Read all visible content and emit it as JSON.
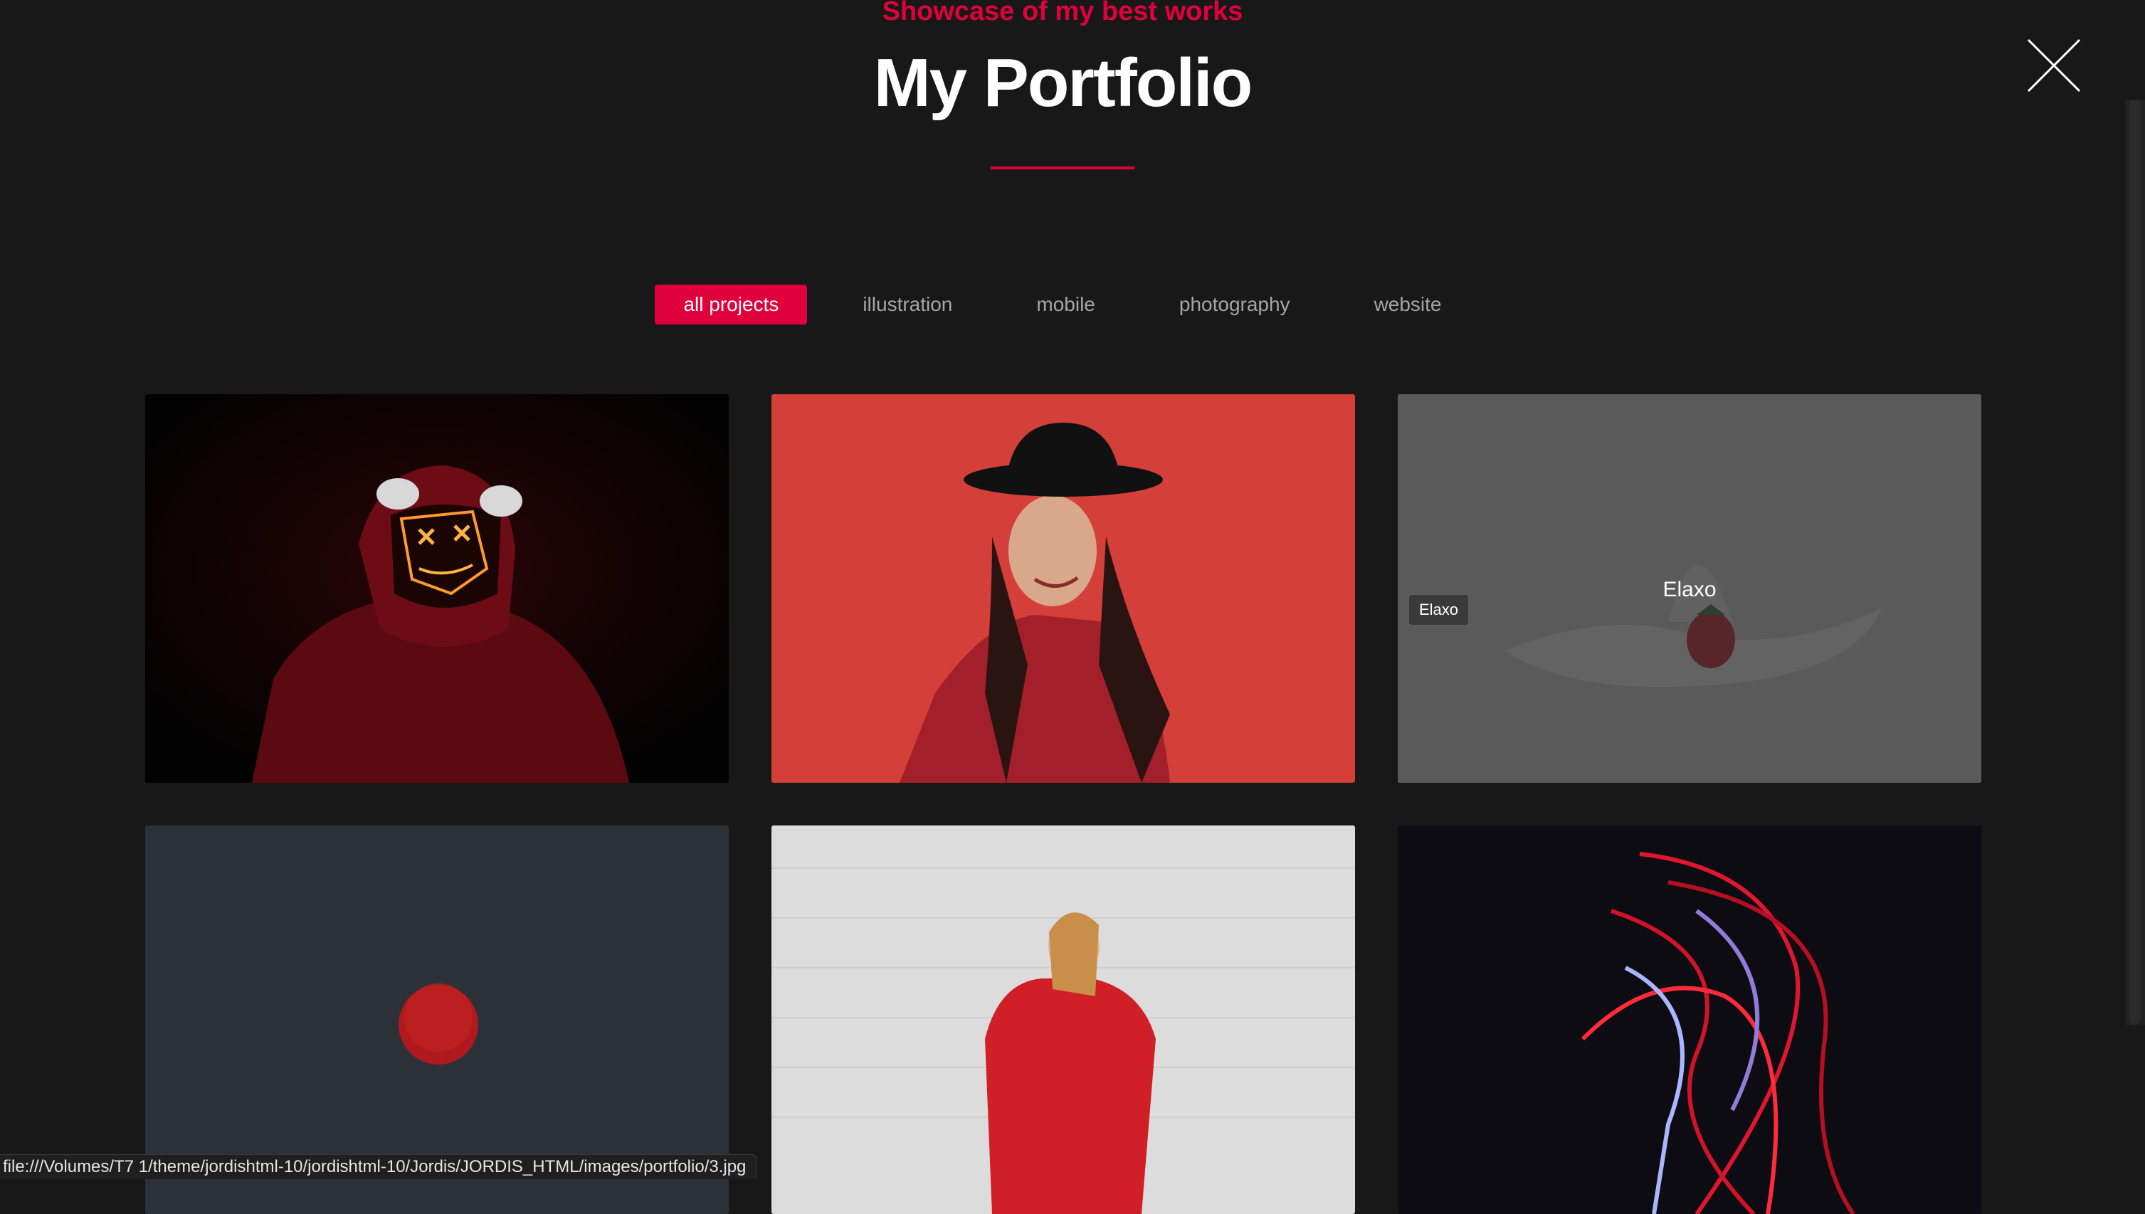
{
  "header": {
    "subtitle": "Showcase of my best works",
    "title": "My Portfolio"
  },
  "filters": [
    {
      "label": "all projects",
      "active": true
    },
    {
      "label": "illustration",
      "active": false
    },
    {
      "label": "mobile",
      "active": false
    },
    {
      "label": "photography",
      "active": false
    },
    {
      "label": "website",
      "active": false
    }
  ],
  "portfolio": {
    "items": [
      {
        "image": "hooded-figure-neon-mask"
      },
      {
        "image": "woman-red-jacket-black-hat"
      },
      {
        "image": "strawberry-milk-splash",
        "tag": "Elaxo",
        "caption": "Elaxo"
      },
      {
        "image": "red-sun-dark-sky"
      },
      {
        "image": "woman-tomato-soup-sweater"
      },
      {
        "image": "red-light-trails"
      }
    ]
  },
  "status_bar": {
    "url": "file:///Volumes/T7 1/theme/jordishtml-10/jordishtml-10/Jordis/JORDIS_HTML/images/portfolio/3.jpg"
  },
  "colors": {
    "accent": "#e0003c",
    "background": "#181818"
  },
  "icons": {
    "close": "close-icon"
  }
}
